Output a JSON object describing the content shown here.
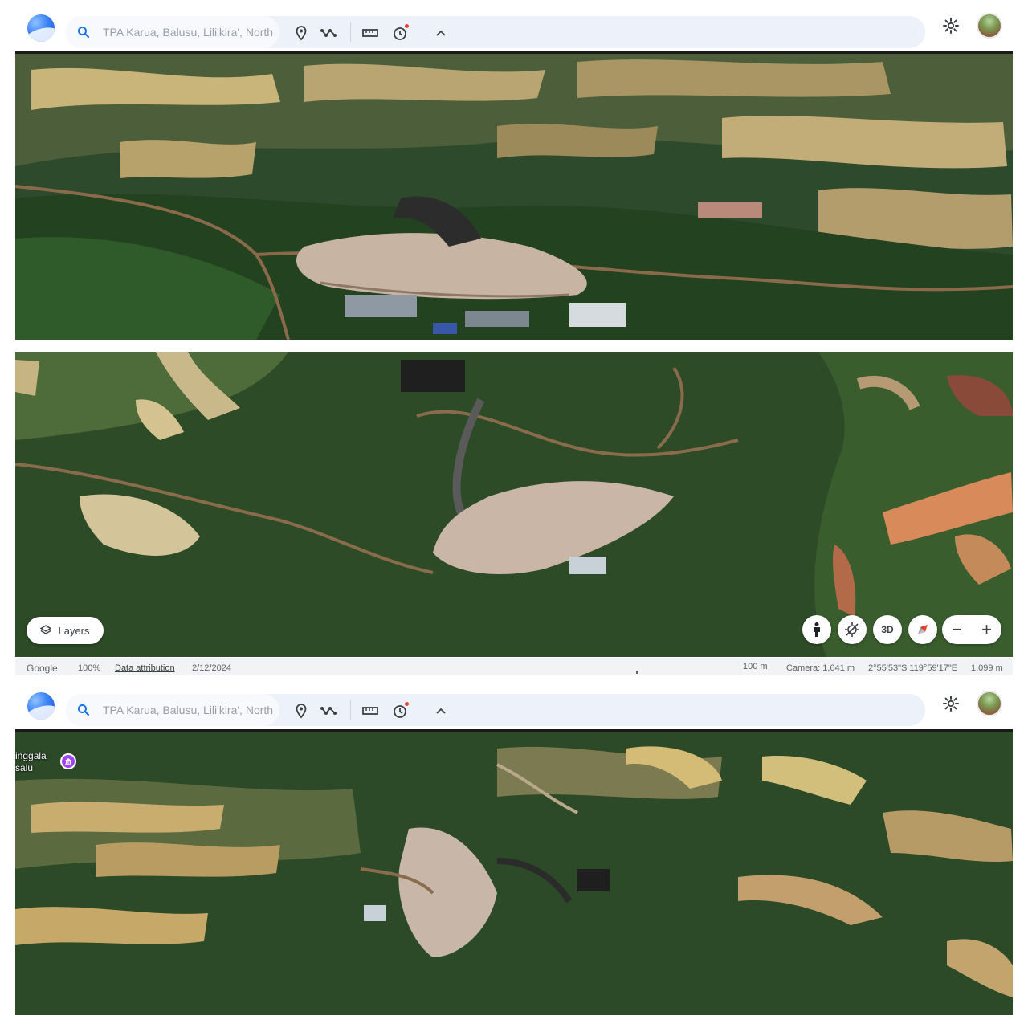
{
  "toolbar": {
    "search_value": "TPA Karua, Balusu, Lili'kira', North",
    "icons": [
      "search-icon",
      "place-pin-icon",
      "path-icon",
      "ruler-icon",
      "history-icon",
      "chevron-up-icon",
      "gear-icon"
    ],
    "accent": "#1a73e8"
  },
  "map_controls": {
    "layers_label": "Layers",
    "view_3d_label": "3D",
    "zoom_out_label": "−",
    "zoom_in_label": "+"
  },
  "status_bar": {
    "brand": "Google",
    "zoom_level": "100%",
    "attribution": "Data attribution",
    "imagery_date": "2/12/2024",
    "scale": "100 m",
    "camera": "Camera: 1,641 m",
    "coordinates": "2°55'53\"S 119°59'17\"E",
    "elevation": "1,099 m"
  },
  "place_label": {
    "line1": "inggala",
    "line2": "salu",
    "pin_icon": "museum-icon",
    "pin_color": "#a142f4"
  }
}
